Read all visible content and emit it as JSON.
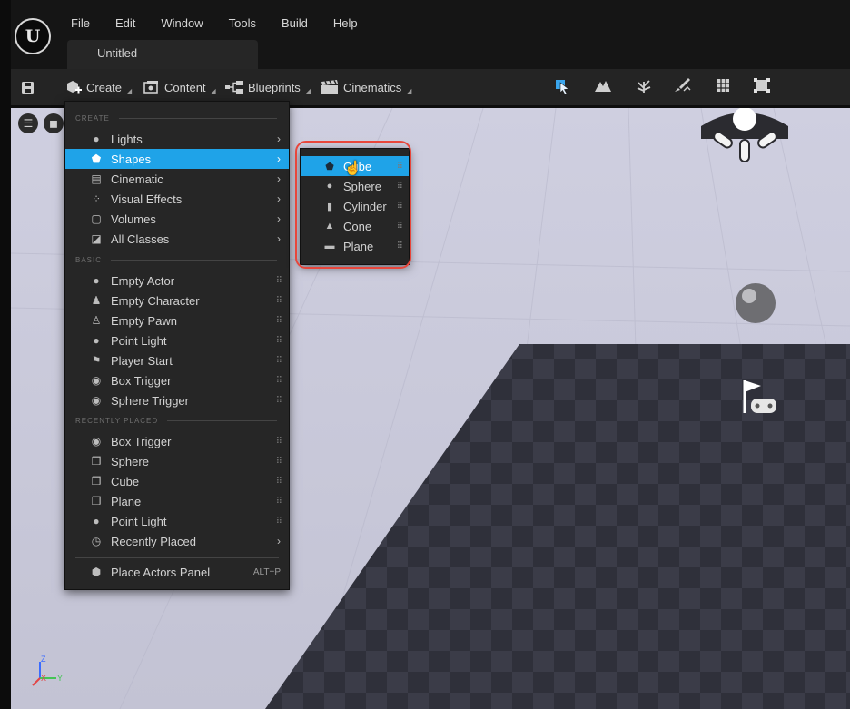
{
  "app": {
    "logo_text": "U"
  },
  "menubar": [
    "File",
    "Edit",
    "Window",
    "Tools",
    "Build",
    "Help"
  ],
  "document_tab": "Untitled",
  "toolbar": {
    "create_label": "Create",
    "content_label": "Content",
    "blueprints_label": "Blueprints",
    "cinematics_label": "Cinematics"
  },
  "create_menu": {
    "sections": {
      "create": "CREATE",
      "basic": "BASIC",
      "recent": "RECENTLY PLACED"
    },
    "create_items": [
      {
        "label": "Lights",
        "icon": "lightbulb-icon"
      },
      {
        "label": "Shapes",
        "icon": "shield-icon"
      },
      {
        "label": "Cinematic",
        "icon": "clapperboard-icon"
      },
      {
        "label": "Visual Effects",
        "icon": "sparkle-icon"
      },
      {
        "label": "Volumes",
        "icon": "box-outline-icon"
      },
      {
        "label": "All Classes",
        "icon": "cubes-icon"
      }
    ],
    "basic_items": [
      {
        "label": "Empty Actor",
        "icon": "sphere-pin-icon"
      },
      {
        "label": "Empty Character",
        "icon": "person-icon"
      },
      {
        "label": "Empty Pawn",
        "icon": "pawn-icon"
      },
      {
        "label": "Point Light",
        "icon": "lightbulb-icon"
      },
      {
        "label": "Player Start",
        "icon": "flag-icon"
      },
      {
        "label": "Box Trigger",
        "icon": "trigger-icon"
      },
      {
        "label": "Sphere Trigger",
        "icon": "trigger-icon"
      }
    ],
    "recent_items": [
      {
        "label": "Box Trigger",
        "icon": "trigger-icon"
      },
      {
        "label": "Sphere",
        "icon": "cube-icon"
      },
      {
        "label": "Cube",
        "icon": "cube-icon"
      },
      {
        "label": "Plane",
        "icon": "cube-icon"
      },
      {
        "label": "Point Light",
        "icon": "lightbulb-icon"
      },
      {
        "label": "Recently Placed",
        "icon": "clock-icon"
      }
    ],
    "footer": {
      "label": "Place Actors Panel",
      "shortcut": "ALT+P"
    }
  },
  "shapes_menu": {
    "items": [
      {
        "label": "Cube",
        "icon": "cube-shield-icon"
      },
      {
        "label": "Sphere",
        "icon": "sphere-icon"
      },
      {
        "label": "Cylinder",
        "icon": "cylinder-icon"
      },
      {
        "label": "Cone",
        "icon": "cone-icon"
      },
      {
        "label": "Plane",
        "icon": "plane-icon"
      }
    ]
  },
  "colors": {
    "highlight": "#1fa3e8",
    "annotation": "#e8463b",
    "menu_bg": "#262626"
  }
}
